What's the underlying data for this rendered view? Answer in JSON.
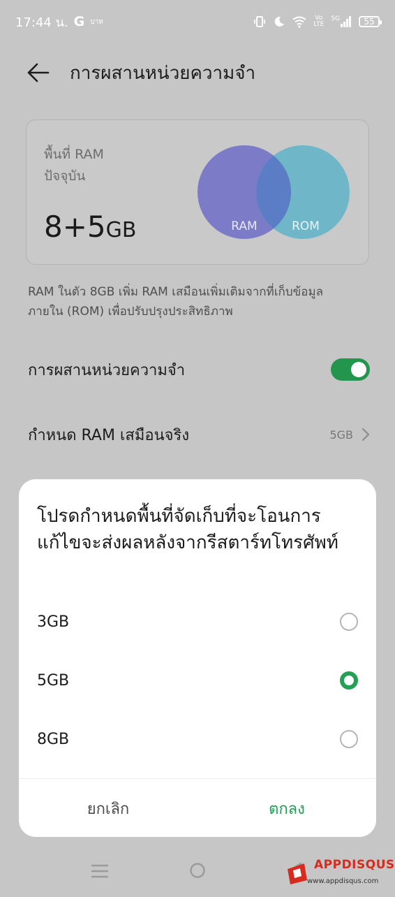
{
  "status_bar": {
    "time": "17:44 น.",
    "google_glyph": "G",
    "extra_label": "บาท",
    "network_top": "Vo",
    "network_bottom": "LTE",
    "network_type": "5G",
    "battery": "55",
    "icons": [
      "vibrate-icon",
      "moon-icon",
      "wifi-icon",
      "signal-icon",
      "battery-icon"
    ]
  },
  "header": {
    "title": "การผสานหน่วยความจำ",
    "back_icon": "back-arrow-icon"
  },
  "ram_card": {
    "label": "พื้นที่ RAM ปัจจุบัน",
    "value": "8+5",
    "unit": "GB",
    "venn_left": "RAM",
    "venn_right": "ROM",
    "colors": {
      "ram": "#7b7bc7",
      "rom": "#6fb6c8",
      "overlap": "#5b7dc5"
    }
  },
  "description": "RAM ในตัว 8GB เพิ่ม RAM เสมือนเพิ่มเติมจากที่เก็บข้อมูลภายใน (ROM) เพื่อปรับปรุงประสิทธิภาพ",
  "settings": {
    "memory_fusion": {
      "label": "การผสานหน่วยความจำ",
      "enabled": true
    },
    "virtual_ram": {
      "label": "กำหนด RAM เสมือนจริง",
      "value": "5GB"
    }
  },
  "dialog": {
    "title": "โปรดกำหนดพื้นที่จัดเก็บที่จะโอนการแก้ไขจะส่งผลหลังจากรีสตาร์ทโทรศัพท์",
    "options": [
      {
        "label": "3GB",
        "selected": false
      },
      {
        "label": "5GB",
        "selected": true
      },
      {
        "label": "8GB",
        "selected": false
      }
    ],
    "cancel_label": "ยกเลิก",
    "ok_label": "ตกลง"
  },
  "nav_bar": {
    "icons": [
      "menu-icon",
      "home-icon",
      "back-icon"
    ]
  },
  "watermark": {
    "brand": "APPDISQUS",
    "url": "www.appdisqus.com"
  },
  "theme": {
    "accent": "#22a053",
    "toggle_on": "#23954c",
    "scrim": "#c6c6c6"
  }
}
